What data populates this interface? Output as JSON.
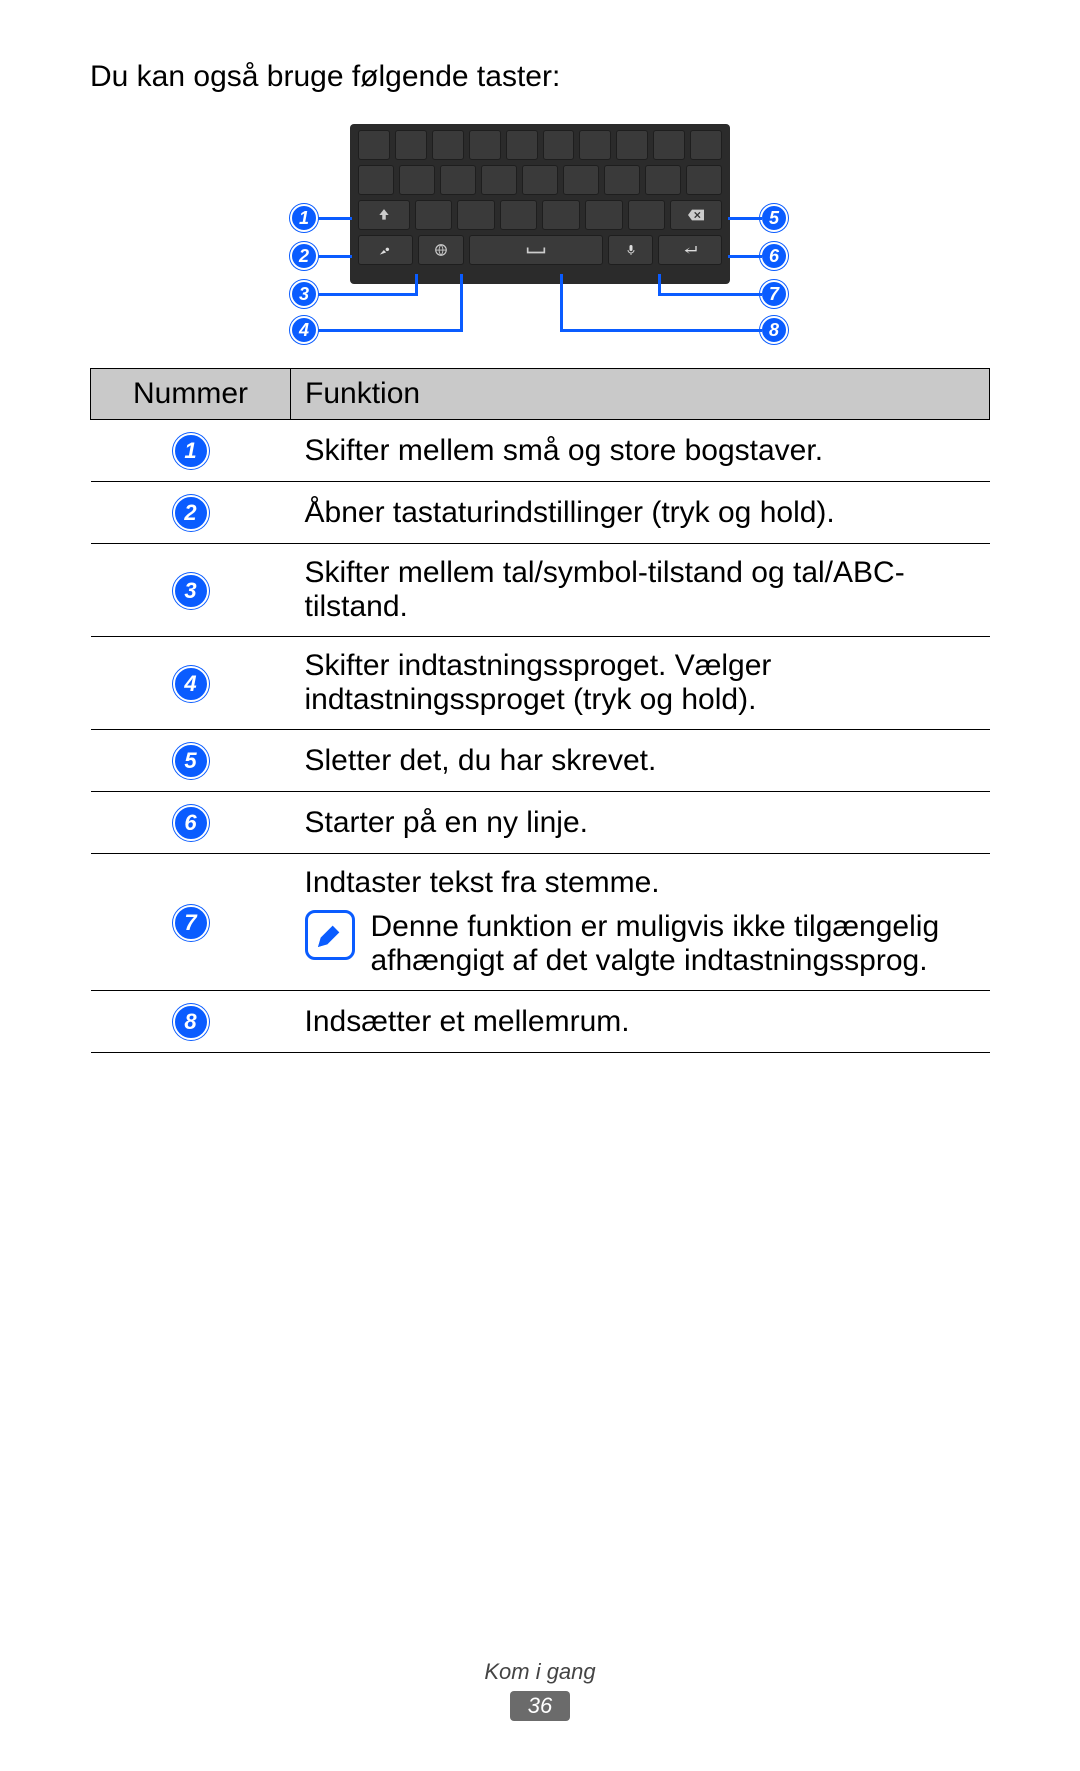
{
  "intro": "Du kan også bruge følgende taster:",
  "table": {
    "headers": {
      "num": "Nummer",
      "func": "Funktion"
    },
    "rows": [
      {
        "n": "1",
        "text": "Skifter mellem små og store bogstaver."
      },
      {
        "n": "2",
        "text": "Åbner tastaturindstillinger (tryk og hold)."
      },
      {
        "n": "3",
        "text": "Skifter mellem tal/symbol-tilstand og tal/ABC-tilstand."
      },
      {
        "n": "4",
        "text": "Skifter indtastningssproget. Vælger indtastningssproget (tryk og hold)."
      },
      {
        "n": "5",
        "text": "Sletter det, du har skrevet."
      },
      {
        "n": "6",
        "text": "Starter på en ny linje."
      },
      {
        "n": "7",
        "text": "Indtaster tekst fra stemme.",
        "note": "Denne funktion er muligvis ikke tilgængelig afhængigt af det valgte indtastningssprog."
      },
      {
        "n": "8",
        "text": "Indsætter et mellemrum."
      }
    ]
  },
  "footer": {
    "section": "Kom i gang",
    "page": "36"
  },
  "diagram": {
    "markers": [
      "1",
      "2",
      "3",
      "4",
      "5",
      "6",
      "7",
      "8"
    ],
    "keys": [
      "shift",
      "settings",
      "symbols",
      "language",
      "backspace",
      "enter",
      "voice",
      "space"
    ]
  }
}
